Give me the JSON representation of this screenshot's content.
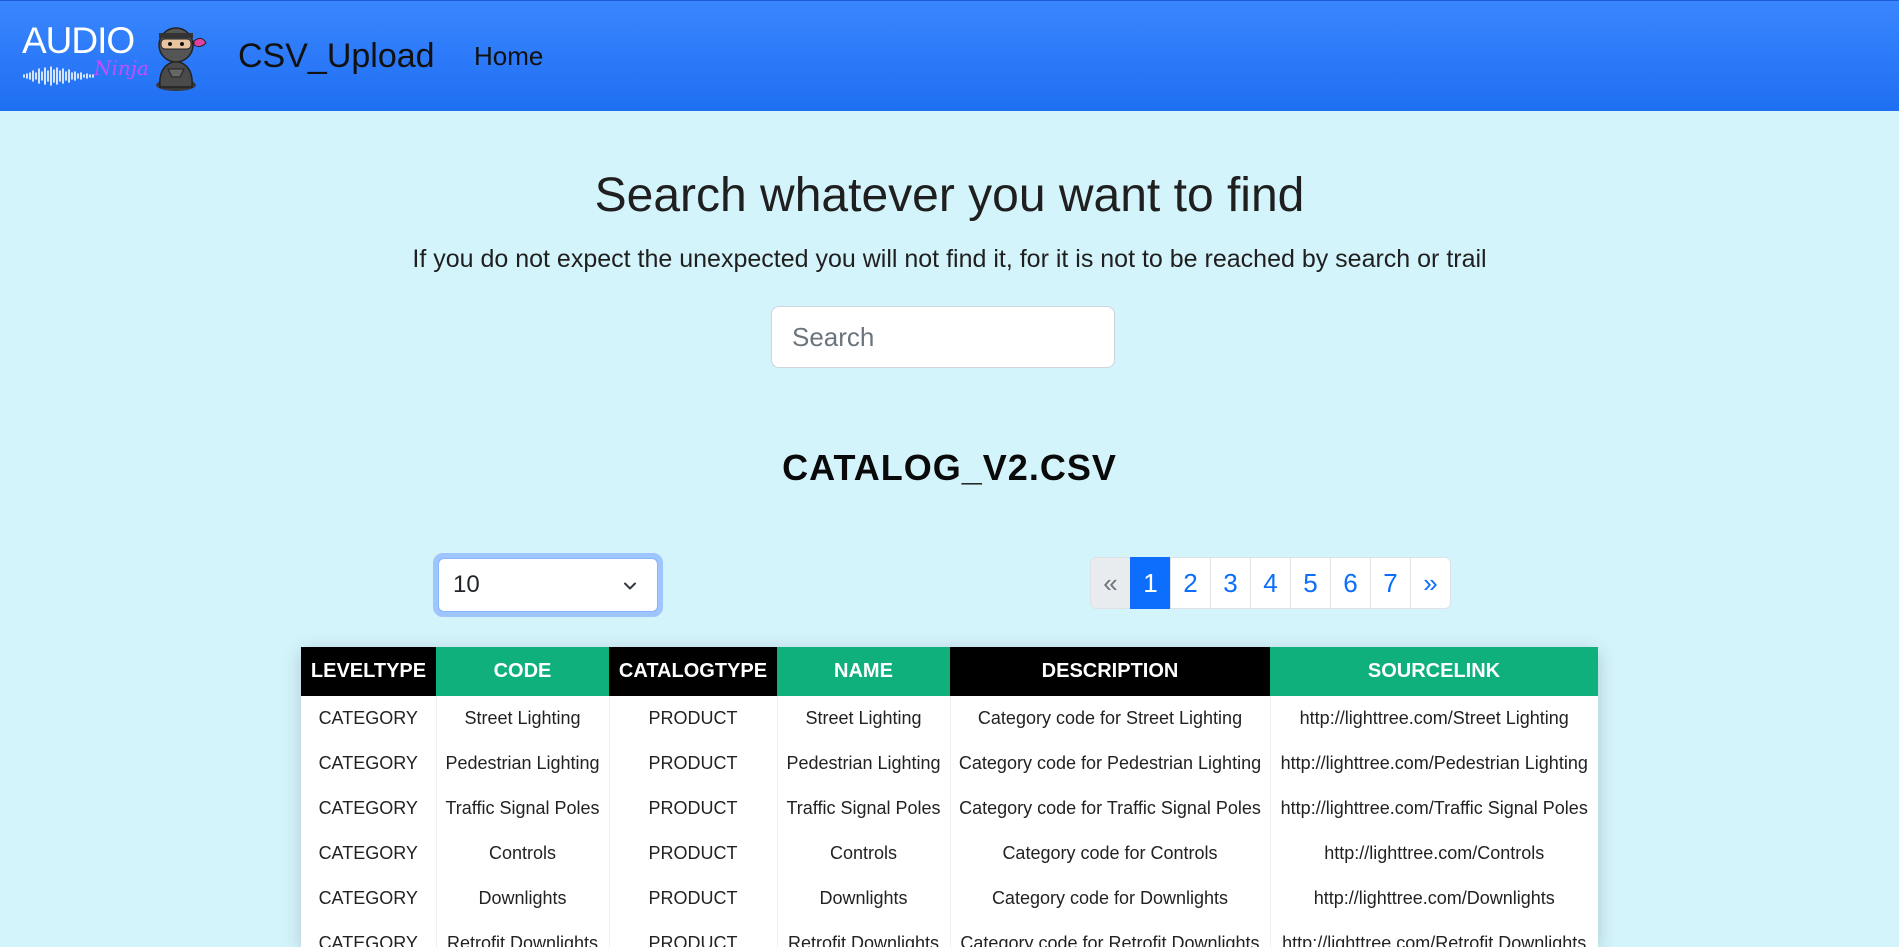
{
  "navbar": {
    "logo_text": "AUDIO",
    "logo_script": "Ninja",
    "brand": "CSV_Upload",
    "home_label": "Home",
    "color": "#2f7bf7"
  },
  "hero": {
    "title": "Search whatever you want to find",
    "subtitle": "If you do not expect the unexpected you will not find it, for it is not to be reached by search or trail"
  },
  "search": {
    "placeholder": "Search",
    "value": ""
  },
  "file": {
    "title": "CATALOG_V2.CSV"
  },
  "page_size": {
    "selected": "10",
    "icon": "chevron-down-icon"
  },
  "pagination": {
    "prev": "«",
    "pages": [
      "1",
      "2",
      "3",
      "4",
      "5",
      "6",
      "7"
    ],
    "next": "»",
    "active": "1"
  },
  "table": {
    "columns": [
      "LEVELTYPE",
      "CODE",
      "CATALOGTYPE",
      "NAME",
      "DESCRIPTION",
      "SOURCELINK"
    ],
    "header_colors": [
      "#000000",
      "#10b07c"
    ],
    "rows": [
      [
        "CATEGORY",
        "Street Lighting",
        "PRODUCT",
        "Street Lighting",
        "Category code for Street Lighting",
        "http://lighttree.com/Street Lighting"
      ],
      [
        "CATEGORY",
        "Pedestrian Lighting",
        "PRODUCT",
        "Pedestrian Lighting",
        "Category code for Pedestrian Lighting",
        "http://lighttree.com/Pedestrian Lighting"
      ],
      [
        "CATEGORY",
        "Traffic Signal Poles",
        "PRODUCT",
        "Traffic Signal Poles",
        "Category code for Traffic Signal Poles",
        "http://lighttree.com/Traffic Signal Poles"
      ],
      [
        "CATEGORY",
        "Controls",
        "PRODUCT",
        "Controls",
        "Category code for Controls",
        "http://lighttree.com/Controls"
      ],
      [
        "CATEGORY",
        "Downlights",
        "PRODUCT",
        "Downlights",
        "Category code for Downlights",
        "http://lighttree.com/Downlights"
      ],
      [
        "CATEGORY",
        "Retrofit Downlights",
        "PRODUCT",
        "Retrofit Downlights",
        "Category code for Retrofit Downlights",
        "http://lighttree.com/Retrofit Downlights"
      ]
    ]
  }
}
